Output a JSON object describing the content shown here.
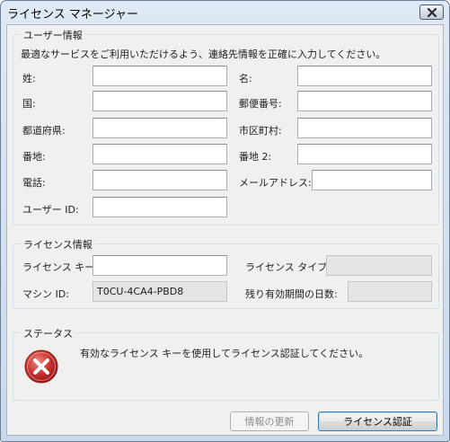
{
  "window": {
    "title": "ライセンス マネージャー"
  },
  "user_info": {
    "legend": "ユーザー情報",
    "description": "最適なサービスをご利用いただけるよう、連絡先情報を正確に入力してください。",
    "last_name_label": "姓:",
    "first_name_label": "名:",
    "country_label": "国:",
    "postal_code_label": "郵便番号:",
    "prefecture_label": "都道府県:",
    "city_label": "市区町村:",
    "address1_label": "番地:",
    "address2_label": "番地 2:",
    "phone_label": "電話:",
    "email_label": "メールアドレス:",
    "user_id_label": "ユーザー ID:",
    "last_name_value": "",
    "first_name_value": "",
    "country_value": "",
    "postal_code_value": "",
    "prefecture_value": "",
    "city_value": "",
    "address1_value": "",
    "address2_value": "",
    "phone_value": "",
    "email_value": "",
    "user_id_value": ""
  },
  "license_info": {
    "legend": "ライセンス情報",
    "key_label": "ライセンス キー:",
    "key_value": "",
    "type_label": "ライセンス タイプ:",
    "type_value": "",
    "machine_id_label": "マシン ID:",
    "machine_id_value": "T0CU-4CA4-PBD8",
    "days_remaining_label": "残り有効期間の日数:",
    "days_remaining_value": ""
  },
  "status": {
    "legend": "ステータス",
    "message": "有効なライセンス キーを使用してライセンス認証してください。",
    "icon": "error-icon"
  },
  "buttons": {
    "update_label": "情報の更新",
    "activate_label": "ライセンス認証"
  },
  "colors": {
    "error_red": "#c8302f",
    "default_button_border": "#3c7fb1"
  }
}
